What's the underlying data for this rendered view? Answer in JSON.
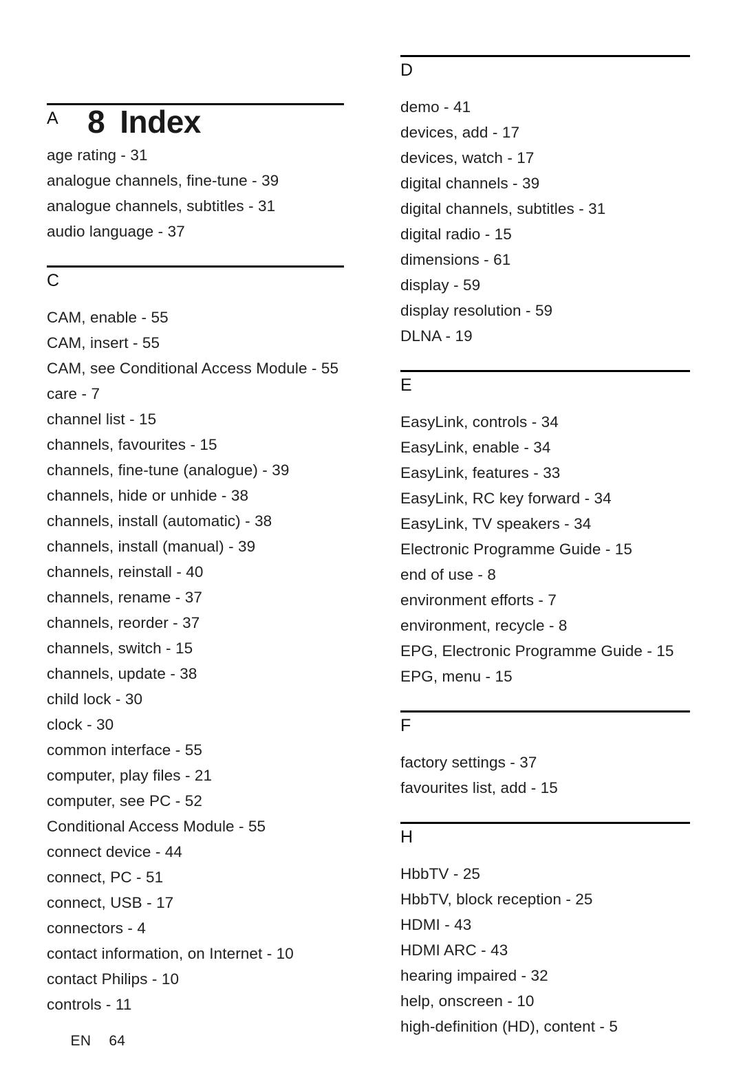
{
  "document": {
    "chapter_number": "8",
    "title": "Index",
    "footer_language": "EN",
    "footer_page_number": "64"
  },
  "left_column": {
    "sections": [
      {
        "letter": "A",
        "entries": [
          "age rating - 31",
          "analogue channels, fine-tune - 39",
          "analogue channels, subtitles - 31",
          "audio language - 37"
        ]
      },
      {
        "letter": "C",
        "entries": [
          "CAM, enable - 55",
          "CAM, insert - 55",
          "CAM, see Conditional Access Module - 55",
          "care - 7",
          "channel list - 15",
          "channels, favourites - 15",
          "channels, fine-tune (analogue) - 39",
          "channels, hide or unhide - 38",
          "channels, install (automatic) - 38",
          "channels, install (manual) - 39",
          "channels, reinstall - 40",
          "channels, rename - 37",
          "channels, reorder - 37",
          "channels, switch - 15",
          "channels, update - 38",
          "child lock - 30",
          "clock - 30",
          "common interface - 55",
          "computer, play files - 21",
          "computer, see PC - 52",
          "Conditional Access Module - 55",
          "connect device - 44",
          "connect, PC - 51",
          "connect, USB - 17",
          "connectors - 4",
          "contact information, on Internet - 10",
          "contact Philips - 10",
          "controls - 11"
        ]
      }
    ]
  },
  "right_column": {
    "sections": [
      {
        "letter": "D",
        "entries": [
          "demo - 41",
          "devices, add - 17",
          "devices, watch - 17",
          "digital channels - 39",
          "digital channels, subtitles - 31",
          "digital radio - 15",
          "dimensions - 61",
          "display - 59",
          "display resolution - 59",
          "DLNA - 19"
        ]
      },
      {
        "letter": "E",
        "entries": [
          "EasyLink, controls - 34",
          "EasyLink, enable - 34",
          "EasyLink, features - 33",
          "EasyLink, RC key forward - 34",
          "EasyLink, TV speakers - 34",
          "Electronic Programme Guide - 15",
          "end of use - 8",
          "environment efforts - 7",
          "environment, recycle - 8",
          "EPG, Electronic Programme Guide - 15",
          "EPG, menu - 15"
        ]
      },
      {
        "letter": "F",
        "entries": [
          "factory settings - 37",
          "favourites list, add - 15"
        ]
      },
      {
        "letter": "H",
        "entries": [
          "HbbTV - 25",
          "HbbTV, block reception - 25",
          "HDMI - 43",
          "HDMI ARC - 43",
          "hearing impaired - 32",
          "help, onscreen - 10",
          "high-definition (HD), content - 5"
        ]
      }
    ]
  }
}
